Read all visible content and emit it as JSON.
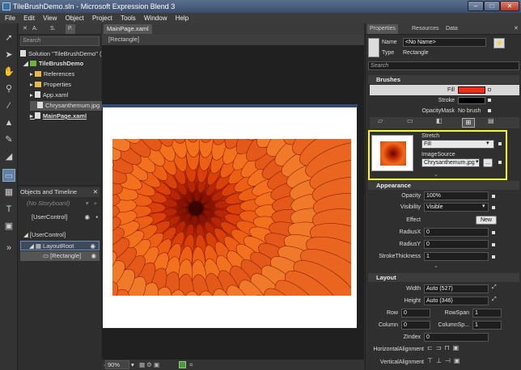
{
  "window": {
    "title": "TileBrushDemo.sln - Microsoft Expression Blend 3",
    "minimize": "–",
    "maximize": "□",
    "close": "✕"
  },
  "menu": [
    "File",
    "Edit",
    "View",
    "Object",
    "Project",
    "Tools",
    "Window",
    "Help"
  ],
  "project_panel": {
    "tabs": [
      "A.",
      "S.",
      "P."
    ],
    "search_placeholder": "Search",
    "solution": "Solution \"TileBrushDemo\" (1",
    "project": "TileBrushDemo",
    "items": [
      "References",
      "Properties",
      "App.xaml",
      "Chrysanthemum.jpg",
      "MainPage.xaml"
    ]
  },
  "objects_panel": {
    "title": "Objects and Timeline",
    "storyboard": "(No Storyboard)",
    "usercontrol_top": "[UserControl]",
    "usercontrol": "[UserControl]",
    "layoutroot": "LayoutRoot",
    "rectangle": "[Rectangle]"
  },
  "document": {
    "tab": "MainPage.xaml",
    "breadcrumb": "[Rectangle]",
    "zoom": "90%"
  },
  "properties": {
    "tabs": [
      "Properties",
      "Resources",
      "Data"
    ],
    "name_label": "Name",
    "name_value": "<No Name>",
    "type_label": "Type",
    "type_value": "Rectangle",
    "search_placeholder": "Search",
    "brushes": {
      "title": "Brushes",
      "fill": "Fill",
      "stroke": "Stroke",
      "opacitymask": "OpacityMask",
      "opacitymask_value": "No brush",
      "stretch_label": "Stretch",
      "stretch_value": "Fill",
      "imagesource_label": "ImageSource",
      "imagesource_value": "Chrysanthemum.jpg",
      "browse": "..."
    },
    "appearance": {
      "title": "Appearance",
      "opacity_label": "Opacity",
      "opacity_value": "100%",
      "visibility_label": "Visibility",
      "visibility_value": "Visible",
      "effect_label": "Effect",
      "effect_button": "New",
      "radiusx_label": "RadiusX",
      "radiusx_value": "0",
      "radiusy_label": "RadiusY",
      "radiusy_value": "0",
      "strokethickness_label": "StrokeThickness",
      "strokethickness_value": "1"
    },
    "layout": {
      "title": "Layout",
      "width_label": "Width",
      "width_value": "Auto (527)",
      "height_label": "Height",
      "height_value": "Auto (346)",
      "row_label": "Row",
      "row_value": "0",
      "rowspan_label": "RowSpan",
      "rowspan_value": "1",
      "column_label": "Column",
      "column_value": "0",
      "columnspan_label": "ColumnSp...",
      "columnspan_value": "1",
      "zindex_label": "ZIndex",
      "zindex_value": "0",
      "halign_label": "HorizontalAlignment",
      "valign_label": "VerticalAlignment"
    }
  },
  "colors": {
    "highlight": "#ffff00",
    "fill_swatch": "#e8301a",
    "accent": "#5d7fa8"
  }
}
